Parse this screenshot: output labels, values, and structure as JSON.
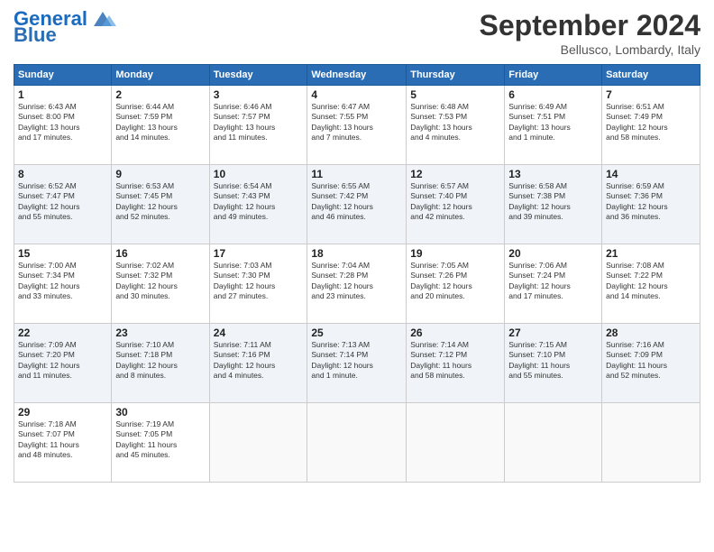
{
  "header": {
    "logo_line1": "General",
    "logo_line2": "Blue",
    "month": "September 2024",
    "location": "Bellusco, Lombardy, Italy"
  },
  "days_of_week": [
    "Sunday",
    "Monday",
    "Tuesday",
    "Wednesday",
    "Thursday",
    "Friday",
    "Saturday"
  ],
  "weeks": [
    [
      {
        "day": "1",
        "info": "Sunrise: 6:43 AM\nSunset: 8:00 PM\nDaylight: 13 hours\nand 17 minutes."
      },
      {
        "day": "2",
        "info": "Sunrise: 6:44 AM\nSunset: 7:59 PM\nDaylight: 13 hours\nand 14 minutes."
      },
      {
        "day": "3",
        "info": "Sunrise: 6:46 AM\nSunset: 7:57 PM\nDaylight: 13 hours\nand 11 minutes."
      },
      {
        "day": "4",
        "info": "Sunrise: 6:47 AM\nSunset: 7:55 PM\nDaylight: 13 hours\nand 7 minutes."
      },
      {
        "day": "5",
        "info": "Sunrise: 6:48 AM\nSunset: 7:53 PM\nDaylight: 13 hours\nand 4 minutes."
      },
      {
        "day": "6",
        "info": "Sunrise: 6:49 AM\nSunset: 7:51 PM\nDaylight: 13 hours\nand 1 minute."
      },
      {
        "day": "7",
        "info": "Sunrise: 6:51 AM\nSunset: 7:49 PM\nDaylight: 12 hours\nand 58 minutes."
      }
    ],
    [
      {
        "day": "8",
        "info": "Sunrise: 6:52 AM\nSunset: 7:47 PM\nDaylight: 12 hours\nand 55 minutes."
      },
      {
        "day": "9",
        "info": "Sunrise: 6:53 AM\nSunset: 7:45 PM\nDaylight: 12 hours\nand 52 minutes."
      },
      {
        "day": "10",
        "info": "Sunrise: 6:54 AM\nSunset: 7:43 PM\nDaylight: 12 hours\nand 49 minutes."
      },
      {
        "day": "11",
        "info": "Sunrise: 6:55 AM\nSunset: 7:42 PM\nDaylight: 12 hours\nand 46 minutes."
      },
      {
        "day": "12",
        "info": "Sunrise: 6:57 AM\nSunset: 7:40 PM\nDaylight: 12 hours\nand 42 minutes."
      },
      {
        "day": "13",
        "info": "Sunrise: 6:58 AM\nSunset: 7:38 PM\nDaylight: 12 hours\nand 39 minutes."
      },
      {
        "day": "14",
        "info": "Sunrise: 6:59 AM\nSunset: 7:36 PM\nDaylight: 12 hours\nand 36 minutes."
      }
    ],
    [
      {
        "day": "15",
        "info": "Sunrise: 7:00 AM\nSunset: 7:34 PM\nDaylight: 12 hours\nand 33 minutes."
      },
      {
        "day": "16",
        "info": "Sunrise: 7:02 AM\nSunset: 7:32 PM\nDaylight: 12 hours\nand 30 minutes."
      },
      {
        "day": "17",
        "info": "Sunrise: 7:03 AM\nSunset: 7:30 PM\nDaylight: 12 hours\nand 27 minutes."
      },
      {
        "day": "18",
        "info": "Sunrise: 7:04 AM\nSunset: 7:28 PM\nDaylight: 12 hours\nand 23 minutes."
      },
      {
        "day": "19",
        "info": "Sunrise: 7:05 AM\nSunset: 7:26 PM\nDaylight: 12 hours\nand 20 minutes."
      },
      {
        "day": "20",
        "info": "Sunrise: 7:06 AM\nSunset: 7:24 PM\nDaylight: 12 hours\nand 17 minutes."
      },
      {
        "day": "21",
        "info": "Sunrise: 7:08 AM\nSunset: 7:22 PM\nDaylight: 12 hours\nand 14 minutes."
      }
    ],
    [
      {
        "day": "22",
        "info": "Sunrise: 7:09 AM\nSunset: 7:20 PM\nDaylight: 12 hours\nand 11 minutes."
      },
      {
        "day": "23",
        "info": "Sunrise: 7:10 AM\nSunset: 7:18 PM\nDaylight: 12 hours\nand 8 minutes."
      },
      {
        "day": "24",
        "info": "Sunrise: 7:11 AM\nSunset: 7:16 PM\nDaylight: 12 hours\nand 4 minutes."
      },
      {
        "day": "25",
        "info": "Sunrise: 7:13 AM\nSunset: 7:14 PM\nDaylight: 12 hours\nand 1 minute."
      },
      {
        "day": "26",
        "info": "Sunrise: 7:14 AM\nSunset: 7:12 PM\nDaylight: 11 hours\nand 58 minutes."
      },
      {
        "day": "27",
        "info": "Sunrise: 7:15 AM\nSunset: 7:10 PM\nDaylight: 11 hours\nand 55 minutes."
      },
      {
        "day": "28",
        "info": "Sunrise: 7:16 AM\nSunset: 7:09 PM\nDaylight: 11 hours\nand 52 minutes."
      }
    ],
    [
      {
        "day": "29",
        "info": "Sunrise: 7:18 AM\nSunset: 7:07 PM\nDaylight: 11 hours\nand 48 minutes."
      },
      {
        "day": "30",
        "info": "Sunrise: 7:19 AM\nSunset: 7:05 PM\nDaylight: 11 hours\nand 45 minutes."
      },
      {
        "day": "",
        "info": ""
      },
      {
        "day": "",
        "info": ""
      },
      {
        "day": "",
        "info": ""
      },
      {
        "day": "",
        "info": ""
      },
      {
        "day": "",
        "info": ""
      }
    ]
  ]
}
